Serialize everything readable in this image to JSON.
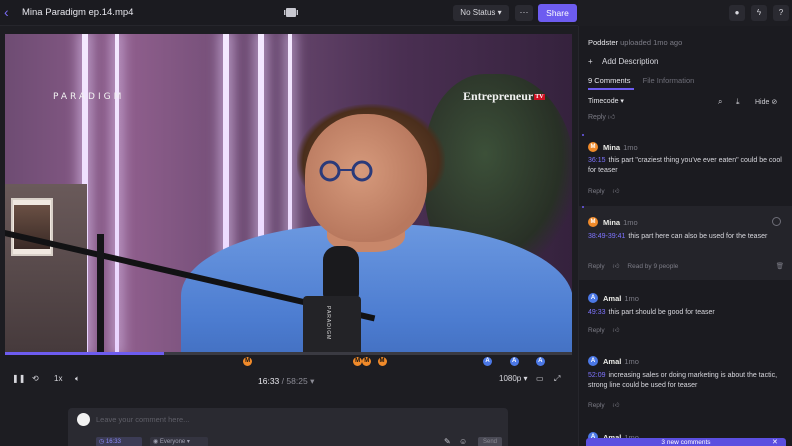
{
  "header": {
    "title": "Mina Paradigm ep.14.mp4",
    "status_label": "No Status",
    "more_label": "···",
    "share_label": "Share",
    "right_icons": [
      "user-icon",
      "lightning-icon",
      "help-icon"
    ]
  },
  "video": {
    "watermark_left": "PARADIGM",
    "watermark_right": "Entrepreneur",
    "watermark_right_badge": "TV",
    "mic_brand": "PARADIGM"
  },
  "player": {
    "progress": 0.28,
    "current_time": "16:33",
    "separator": "/",
    "duration": "58:25",
    "speed": "1x",
    "quality": "1080p",
    "markers": [
      {
        "type": "M",
        "color": "#f08a2a",
        "pos": 0.428
      },
      {
        "type": "M",
        "color": "#f08a2a",
        "pos": 0.622
      },
      {
        "type": "M",
        "color": "#f08a2a",
        "pos": 0.638
      },
      {
        "type": "M",
        "color": "#f08a2a",
        "pos": 0.665
      },
      {
        "type": "A",
        "color": "#4b78e6",
        "pos": 0.851
      },
      {
        "type": "A",
        "color": "#4b78e6",
        "pos": 0.898
      },
      {
        "type": "A",
        "color": "#4b78e6",
        "pos": 0.944
      }
    ]
  },
  "composer": {
    "placeholder": "Leave your comment here...",
    "timecode_chip": "16:33",
    "visibility_chip": "Everyone",
    "send_label": "Send"
  },
  "panel": {
    "uploader_name": "Poddster",
    "uploader_meta": "uploaded 1mo ago",
    "add_description": "Add Description",
    "tab_comments": "9 Comments",
    "tab_info": "File Information",
    "sort_label": "Timecode",
    "hide_label": "Hide",
    "reply_label": "Reply",
    "comments": [
      {
        "initial": "M",
        "author": "Mina",
        "age": "1mo",
        "timecode": "36:15",
        "text": "this part \"craziest thing you've ever eaten\" could be cool for teaser",
        "footer_extra": ""
      },
      {
        "initial": "M",
        "author": "Mina",
        "age": "1mo",
        "timecode": "38:49-39:41",
        "text": "this part here can also be used for the teaser",
        "footer_extra": "Read by 9 people"
      },
      {
        "initial": "A",
        "author": "Amal",
        "age": "1mo",
        "timecode": "49:33",
        "text": "this part should be good for teaser",
        "footer_extra": ""
      },
      {
        "initial": "A",
        "author": "Amal",
        "age": "1mo",
        "timecode": "52:09",
        "text": "increasing sales or doing marketing is  about the tactic, strong line could be used for teaser",
        "footer_extra": ""
      },
      {
        "initial": "A",
        "author": "Amal",
        "age": "1mo",
        "timecode": "",
        "text": "",
        "footer_extra": ""
      }
    ],
    "new_comments": "3 new comments"
  },
  "colors": {
    "accent": "#6d5cf0",
    "orange": "#f08a2a",
    "blue": "#4b78e6",
    "timecode": "#7e74ff"
  }
}
